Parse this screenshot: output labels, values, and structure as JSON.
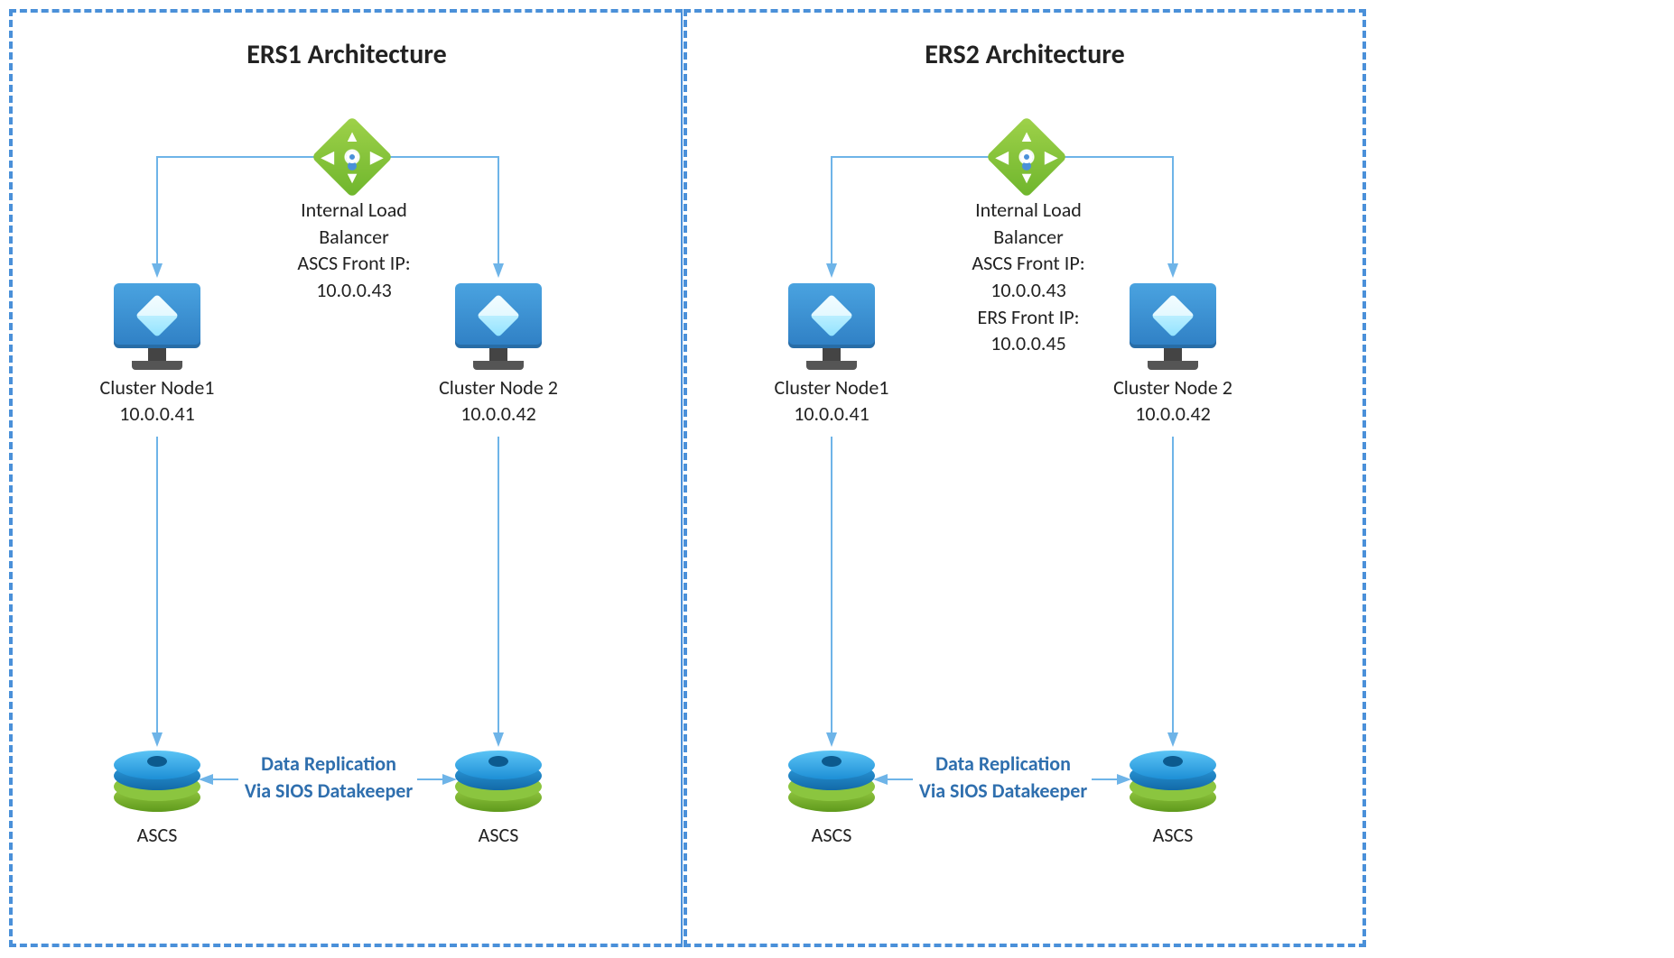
{
  "panels": [
    {
      "title": "ERS1 Architecture",
      "lb_lines": [
        "Internal Load",
        "Balancer",
        "ASCS Front IP:",
        "10.0.0.43"
      ],
      "node1": {
        "name": "Cluster Node1",
        "ip": "10.0.0.41"
      },
      "node2": {
        "name": "Cluster Node 2",
        "ip": "10.0.0.42"
      },
      "replication": [
        "Data Replication",
        "Via SIOS Datakeeper"
      ],
      "disk_label": "ASCS"
    },
    {
      "title": "ERS2 Architecture",
      "lb_lines": [
        "Internal Load",
        "Balancer",
        "ASCS Front IP:",
        "10.0.0.43",
        "ERS Front IP:",
        "10.0.0.45"
      ],
      "node1": {
        "name": "Cluster Node1",
        "ip": "10.0.0.41"
      },
      "node2": {
        "name": "Cluster Node 2",
        "ip": "10.0.0.42"
      },
      "replication": [
        "Data Replication",
        "Via SIOS Datakeeper"
      ],
      "disk_label": "ASCS"
    }
  ]
}
